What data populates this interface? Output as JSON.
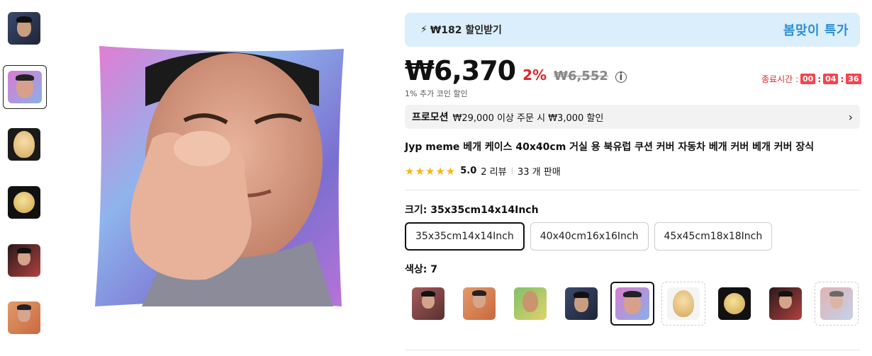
{
  "promo_bar": {
    "amount": "₩182 할인받기",
    "badge": "봄맞이 특가"
  },
  "price": {
    "current": "₩6,370",
    "discount": "2%",
    "original": "₩6,552",
    "info": "i",
    "coin_note": "1% 추가 코인 할인"
  },
  "timer": {
    "label": "종료시간 :",
    "hours": "00",
    "minutes": "04",
    "seconds": "36",
    "sep": ":"
  },
  "promotion": {
    "tag": "프로모션",
    "text": "₩29,000 이상 주문 시 ₩3,000 할인",
    "chevron": "›"
  },
  "product": {
    "title": "Jyp meme 베개 케이스 40x40cm 거실 용 북유럽 쿠션 커버 자동차 베개 커버 베개 커버 장식"
  },
  "rating": {
    "stars": "★★★★★",
    "score": "5.0",
    "reviews": "2 리뷰",
    "sep": "|",
    "sold": "33 개 판매"
  },
  "size": {
    "label": "크기: 35x35cm14x14Inch",
    "options": [
      "35x35cm14x14Inch",
      "40x40cm16x16Inch",
      "45x45cm18x18Inch"
    ],
    "selected_index": 0
  },
  "color": {
    "label": "색상: 7",
    "selected_index": 4
  },
  "thumbnails": [
    "dark-face-pillow",
    "finger-heart-pillow",
    "egg-face-pillow",
    "moon-face-pillow",
    "dance-pillow",
    "orange-shirt-pillow"
  ],
  "colors": {
    "accent_red": "#e0272d",
    "promo_blue": "#2b8fd6",
    "star_yellow": "#f8b617"
  }
}
